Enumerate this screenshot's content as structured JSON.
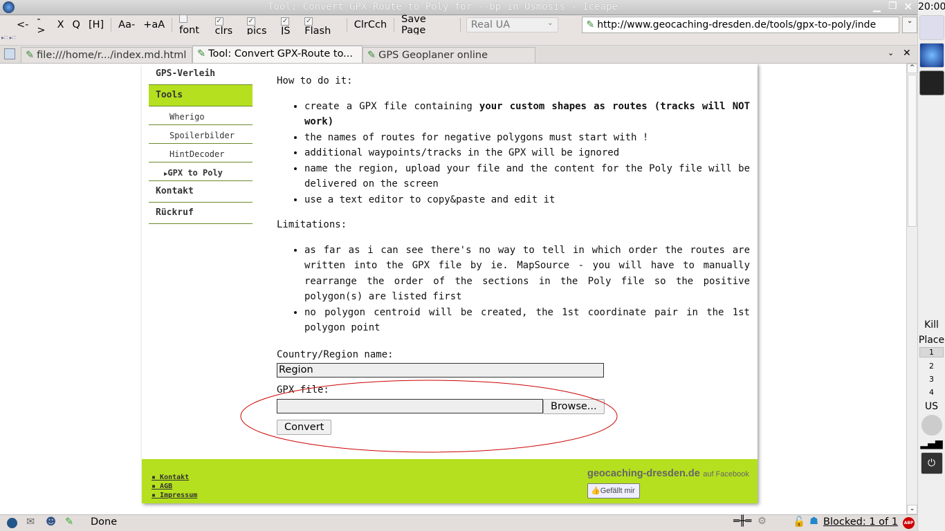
{
  "window": {
    "title": "Tool: Convert GPX-Route to Poly for --bp in Osmosis - Iceape"
  },
  "toolbar": {
    "items": [
      "<-",
      "->",
      "X",
      "Q",
      "[H]",
      "Aa-",
      "+aA"
    ],
    "toggles": [
      {
        "label": "font",
        "checked": false
      },
      {
        "label": "clrs",
        "checked": true
      },
      {
        "label": "pics",
        "checked": true
      },
      {
        "label": "JS",
        "checked": true
      },
      {
        "label": "Flash",
        "checked": true
      }
    ],
    "clear_cache": "ClrCch",
    "save_page": "Save Page",
    "ua_select": "Real UA",
    "url": "http://www.geocaching-dresden.de/tools/gpx-to-poly/inde"
  },
  "tabs": [
    {
      "label": "file:///home/r.../index.md.html",
      "active": false
    },
    {
      "label": "Tool: Convert GPX-Route to...",
      "active": true
    },
    {
      "label": "GPS Geoplaner online",
      "active": false
    }
  ],
  "sidebar": {
    "items": [
      {
        "label": "GPS-Verleih"
      },
      {
        "label": "Tools",
        "active": true
      }
    ],
    "sub": [
      "Wherigo",
      "Spoilerbilder",
      "HintDecoder",
      "GPX to Poly"
    ],
    "after": [
      "Kontakt",
      "Rückruf"
    ]
  },
  "main": {
    "howto_heading": "How to do it:",
    "howto": [
      {
        "pre": "create a GPX file containing ",
        "bold": "your custom shapes as routes (tracks will NOT work)"
      },
      {
        "pre": "the names of routes for negative polygons must start with !"
      },
      {
        "pre": "additional waypoints/tracks in the GPX will be ignored"
      },
      {
        "pre": "name the region, upload your file and the content for the Poly file will be delivered on the screen"
      },
      {
        "pre": "use a text editor to copy&paste and edit it"
      }
    ],
    "limits_heading": "Limitations:",
    "limits": [
      "as far as i can see there's no way to tell in which order the routes are written into the GPX file by ie. MapSource - you will have to manually rearrange the order of the sections in the Poly file so the positive polygon(s) are listed first",
      "no polygon centroid will be created, the 1st coordinate pair in the 1st polygon point"
    ],
    "region_label": "Country/Region name:",
    "region_value": "Region",
    "gpx_label": "GPX file:",
    "browse": "Browse...",
    "convert": "Convert"
  },
  "footer": {
    "links": [
      "Kontakt",
      "AGB",
      "Impressum"
    ],
    "fb_site": "geocaching-dresden.de",
    "fb_suffix": "auf Facebook",
    "like": "Gefällt mir"
  },
  "status": {
    "text": "Done",
    "blocked": "Blocked: 1 of 1",
    "abp": "ABP"
  },
  "panel": {
    "clock": "20:00",
    "kill": "Kill",
    "place": "Place",
    "desks": [
      "1",
      "2",
      "3",
      "4"
    ],
    "kbd": "US"
  },
  "colors": {
    "accent": "#b5e01f",
    "annotation": "#cc0000"
  }
}
